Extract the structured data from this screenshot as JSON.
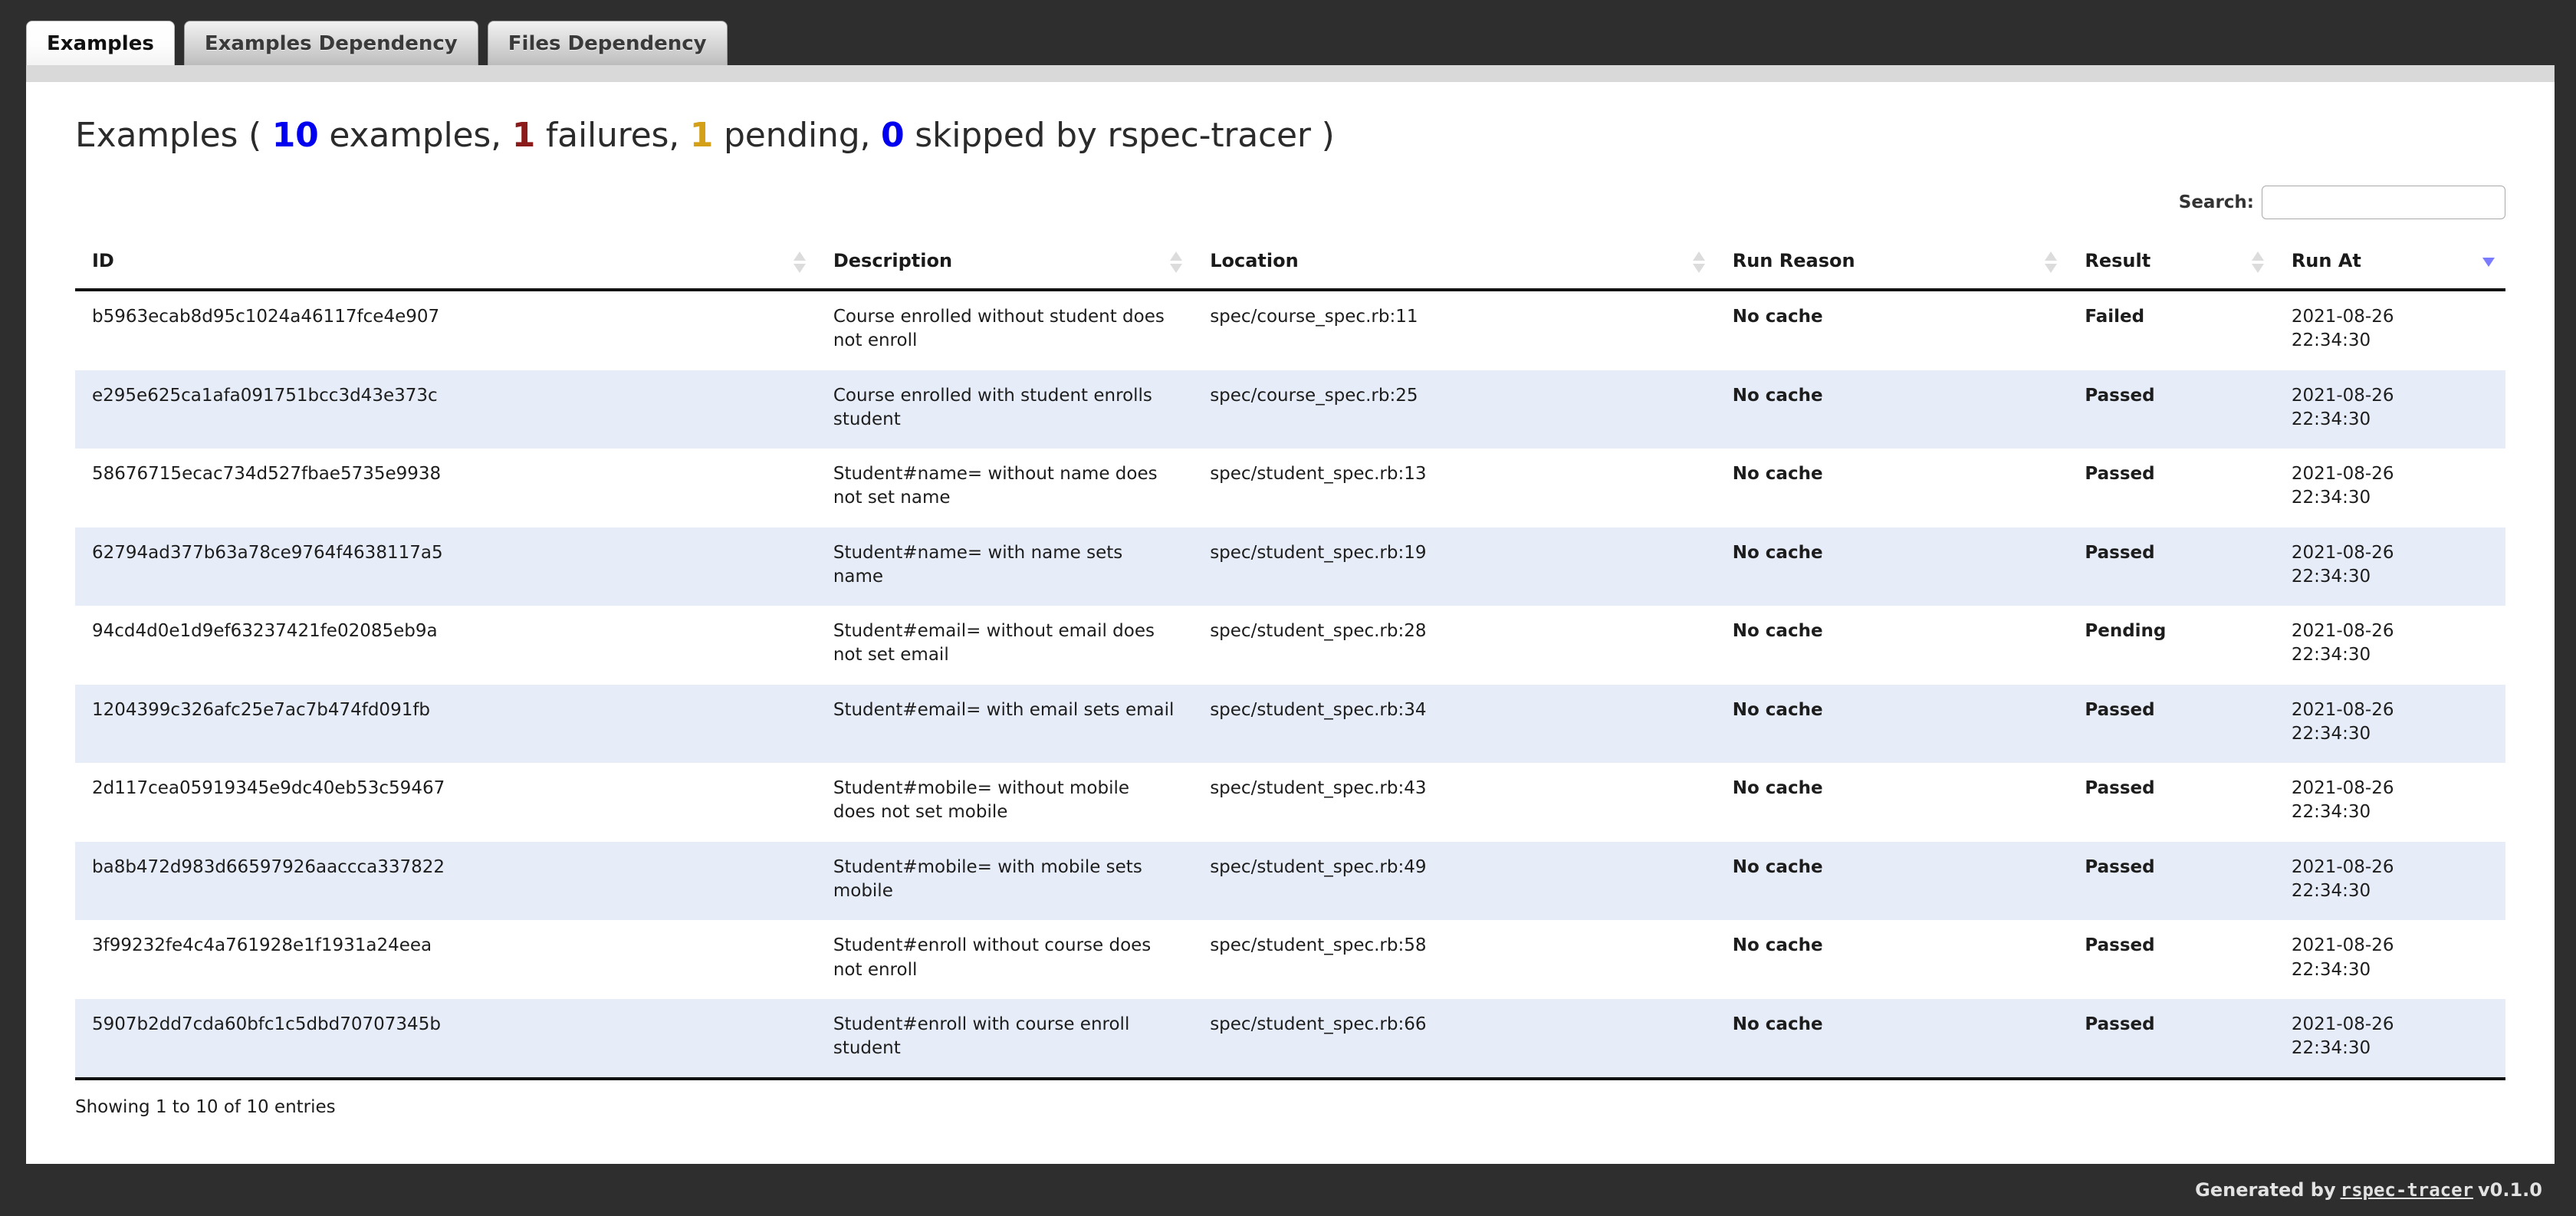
{
  "tabs": [
    {
      "label": "Examples",
      "active": true
    },
    {
      "label": "Examples Dependency",
      "active": false
    },
    {
      "label": "Files Dependency",
      "active": false
    }
  ],
  "title": {
    "prefix": "Examples ( ",
    "examples_count": "10",
    "examples_word": " examples, ",
    "failures_count": "1",
    "failures_word": " failures, ",
    "pending_count": "1",
    "pending_word": " pending, ",
    "skipped_count": "0",
    "skipped_word": " skipped by rspec-tracer )"
  },
  "search": {
    "label": "Search:",
    "value": "",
    "placeholder": ""
  },
  "table": {
    "columns": [
      {
        "label": "ID",
        "sort": "none"
      },
      {
        "label": "Description",
        "sort": "none"
      },
      {
        "label": "Location",
        "sort": "none"
      },
      {
        "label": "Run Reason",
        "sort": "none"
      },
      {
        "label": "Result",
        "sort": "none"
      },
      {
        "label": "Run At",
        "sort": "desc"
      }
    ],
    "rows": [
      {
        "id": "b5963ecab8d95c1024a46117fce4e907",
        "description": "Course enrolled without student does not enroll",
        "location": "spec/course_spec.rb:11",
        "run_reason": "No cache",
        "result": "Failed",
        "run_at_date": "2021-08-26",
        "run_at_time": "22:34:30"
      },
      {
        "id": "e295e625ca1afa091751bcc3d43e373c",
        "description": "Course enrolled with student enrolls student",
        "location": "spec/course_spec.rb:25",
        "run_reason": "No cache",
        "result": "Passed",
        "run_at_date": "2021-08-26",
        "run_at_time": "22:34:30"
      },
      {
        "id": "58676715ecac734d527fbae5735e9938",
        "description": "Student#name= without name does not set name",
        "location": "spec/student_spec.rb:13",
        "run_reason": "No cache",
        "result": "Passed",
        "run_at_date": "2021-08-26",
        "run_at_time": "22:34:30"
      },
      {
        "id": "62794ad377b63a78ce9764f4638117a5",
        "description": "Student#name= with name sets name",
        "location": "spec/student_spec.rb:19",
        "run_reason": "No cache",
        "result": "Passed",
        "run_at_date": "2021-08-26",
        "run_at_time": "22:34:30"
      },
      {
        "id": "94cd4d0e1d9ef63237421fe02085eb9a",
        "description": "Student#email= without email does not set email",
        "location": "spec/student_spec.rb:28",
        "run_reason": "No cache",
        "result": "Pending",
        "run_at_date": "2021-08-26",
        "run_at_time": "22:34:30"
      },
      {
        "id": "1204399c326afc25e7ac7b474fd091fb",
        "description": "Student#email= with email sets email",
        "location": "spec/student_spec.rb:34",
        "run_reason": "No cache",
        "result": "Passed",
        "run_at_date": "2021-08-26",
        "run_at_time": "22:34:30"
      },
      {
        "id": "2d117cea05919345e9dc40eb53c59467",
        "description": "Student#mobile= without mobile does not set mobile",
        "location": "spec/student_spec.rb:43",
        "run_reason": "No cache",
        "result": "Passed",
        "run_at_date": "2021-08-26",
        "run_at_time": "22:34:30"
      },
      {
        "id": "ba8b472d983d66597926aaccca337822",
        "description": "Student#mobile= with mobile sets mobile",
        "location": "spec/student_spec.rb:49",
        "run_reason": "No cache",
        "result": "Passed",
        "run_at_date": "2021-08-26",
        "run_at_time": "22:34:30"
      },
      {
        "id": "3f99232fe4c4a761928e1f1931a24eea",
        "description": "Student#enroll without course does not enroll",
        "location": "spec/student_spec.rb:58",
        "run_reason": "No cache",
        "result": "Passed",
        "run_at_date": "2021-08-26",
        "run_at_time": "22:34:30"
      },
      {
        "id": "5907b2dd7cda60bfc1c5dbd70707345b",
        "description": "Student#enroll with course enroll student",
        "location": "spec/student_spec.rb:66",
        "run_reason": "No cache",
        "result": "Passed",
        "run_at_date": "2021-08-26",
        "run_at_time": "22:34:30"
      }
    ],
    "info": "Showing 1 to 10 of 10 entries"
  },
  "footer": {
    "generated_by": "Generated by",
    "link": "rspec-tracer",
    "version": "v0.1.0"
  },
  "colors": {
    "blue": "#0000ee",
    "red": "#8b1a1a",
    "amber": "#d4a017",
    "green": "#2e8b2e",
    "stripe": "#e7edf8",
    "chrome": "#2e2e2e"
  }
}
